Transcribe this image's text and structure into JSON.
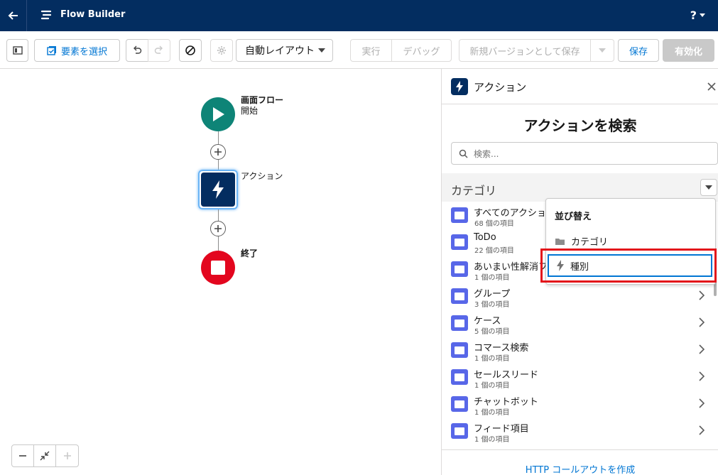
{
  "header": {
    "title": "Flow Builder",
    "help": "?"
  },
  "toolbar": {
    "select_elements": "要素を選択",
    "layout": "自動レイアウト",
    "run": "実行",
    "debug": "デバッグ",
    "save_as_new": "新規バージョンとして保存",
    "save": "保存",
    "activate": "有効化"
  },
  "canvas": {
    "start_title": "画面フロー",
    "start_sub": "開始",
    "action_label": "アクション",
    "end_label": "終了",
    "colors": {
      "start": "#0e8477",
      "action": "#032d60",
      "end": "#e3061e"
    }
  },
  "panel": {
    "title": "アクション",
    "heading": "アクションを検索",
    "search_placeholder": "検索...",
    "section": "カテゴリ",
    "items": [
      {
        "name": "すべてのアクション",
        "count": "68 個の項目"
      },
      {
        "name": "ToDo",
        "count": "22 個の項目"
      },
      {
        "name": "あいまい性解消フ",
        "count": "1 個の項目"
      },
      {
        "name": "グループ",
        "count": "3 個の項目"
      },
      {
        "name": "ケース",
        "count": "5 個の項目"
      },
      {
        "name": "コマース検索",
        "count": "1 個の項目"
      },
      {
        "name": "セールスリード",
        "count": "1 個の項目"
      },
      {
        "name": "チャットボット",
        "count": "1 個の項目"
      },
      {
        "name": "フィード項目",
        "count": "1 個の項目"
      }
    ],
    "footer": "HTTP コールアウトを作成"
  },
  "sort": {
    "title": "並び替え",
    "category": "カテゴリ",
    "type": "種別"
  }
}
